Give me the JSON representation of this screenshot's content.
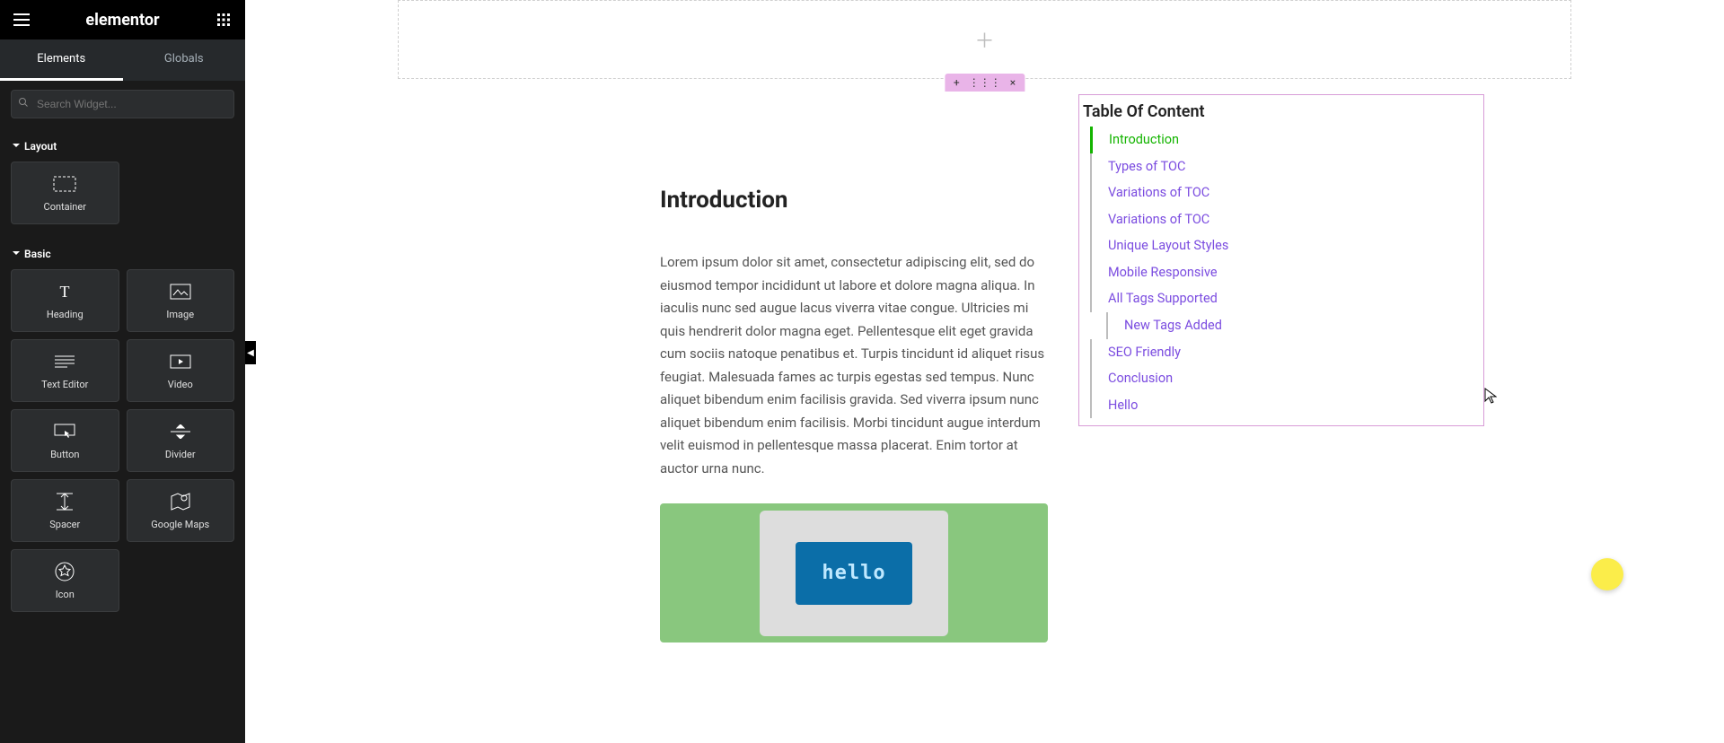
{
  "header": {
    "logo": "elementor"
  },
  "tabs": {
    "elements": "Elements",
    "globals": "Globals"
  },
  "search": {
    "placeholder": "Search Widget..."
  },
  "categories": {
    "layout": "Layout",
    "basic": "Basic"
  },
  "widgets": {
    "container": "Container",
    "heading": "Heading",
    "image": "Image",
    "text_editor": "Text Editor",
    "video": "Video",
    "button": "Button",
    "divider": "Divider",
    "spacer": "Spacer",
    "google_maps": "Google Maps",
    "icon": "Icon"
  },
  "article": {
    "heading": "Introduction",
    "body": "Lorem ipsum dolor sit amet, consectetur adipiscing elit, sed do eiusmod tempor incididunt ut labore et dolore magna aliqua. In iaculis nunc sed augue lacus viverra vitae congue. Ultricies mi quis hendrerit dolor magna eget. Pellentesque elit eget gravida cum sociis natoque penatibus et. Turpis tincidunt id aliquet risus feugiat. Malesuada fames ac turpis egestas sed tempus. Nunc aliquet bibendum enim facilisis gravida. Sed viverra ipsum nunc aliquet bibendum enim facilisis. Morbi tincidunt augue interdum velit euismod in pellentesque massa placerat. Enim tortor at auctor urna nunc.",
    "hello_text": "hello"
  },
  "toc": {
    "title": "Table Of Content",
    "items": [
      {
        "label": "Introduction",
        "active": true,
        "indent": false
      },
      {
        "label": "Types of TOC",
        "active": false,
        "indent": false
      },
      {
        "label": "Variations of TOC",
        "active": false,
        "indent": false
      },
      {
        "label": "Variations of TOC",
        "active": false,
        "indent": false
      },
      {
        "label": "Unique Layout Styles",
        "active": false,
        "indent": false
      },
      {
        "label": "Mobile Responsive",
        "active": false,
        "indent": false
      },
      {
        "label": "All Tags Supported",
        "active": false,
        "indent": false
      },
      {
        "label": "New Tags Added",
        "active": false,
        "indent": true
      },
      {
        "label": "SEO Friendly",
        "active": false,
        "indent": false
      },
      {
        "label": "Conclusion",
        "active": false,
        "indent": false
      },
      {
        "label": "Hello",
        "active": false,
        "indent": false
      }
    ]
  },
  "handle": {
    "add": "+",
    "drag": "⋮⋮⋮",
    "close": "×"
  }
}
